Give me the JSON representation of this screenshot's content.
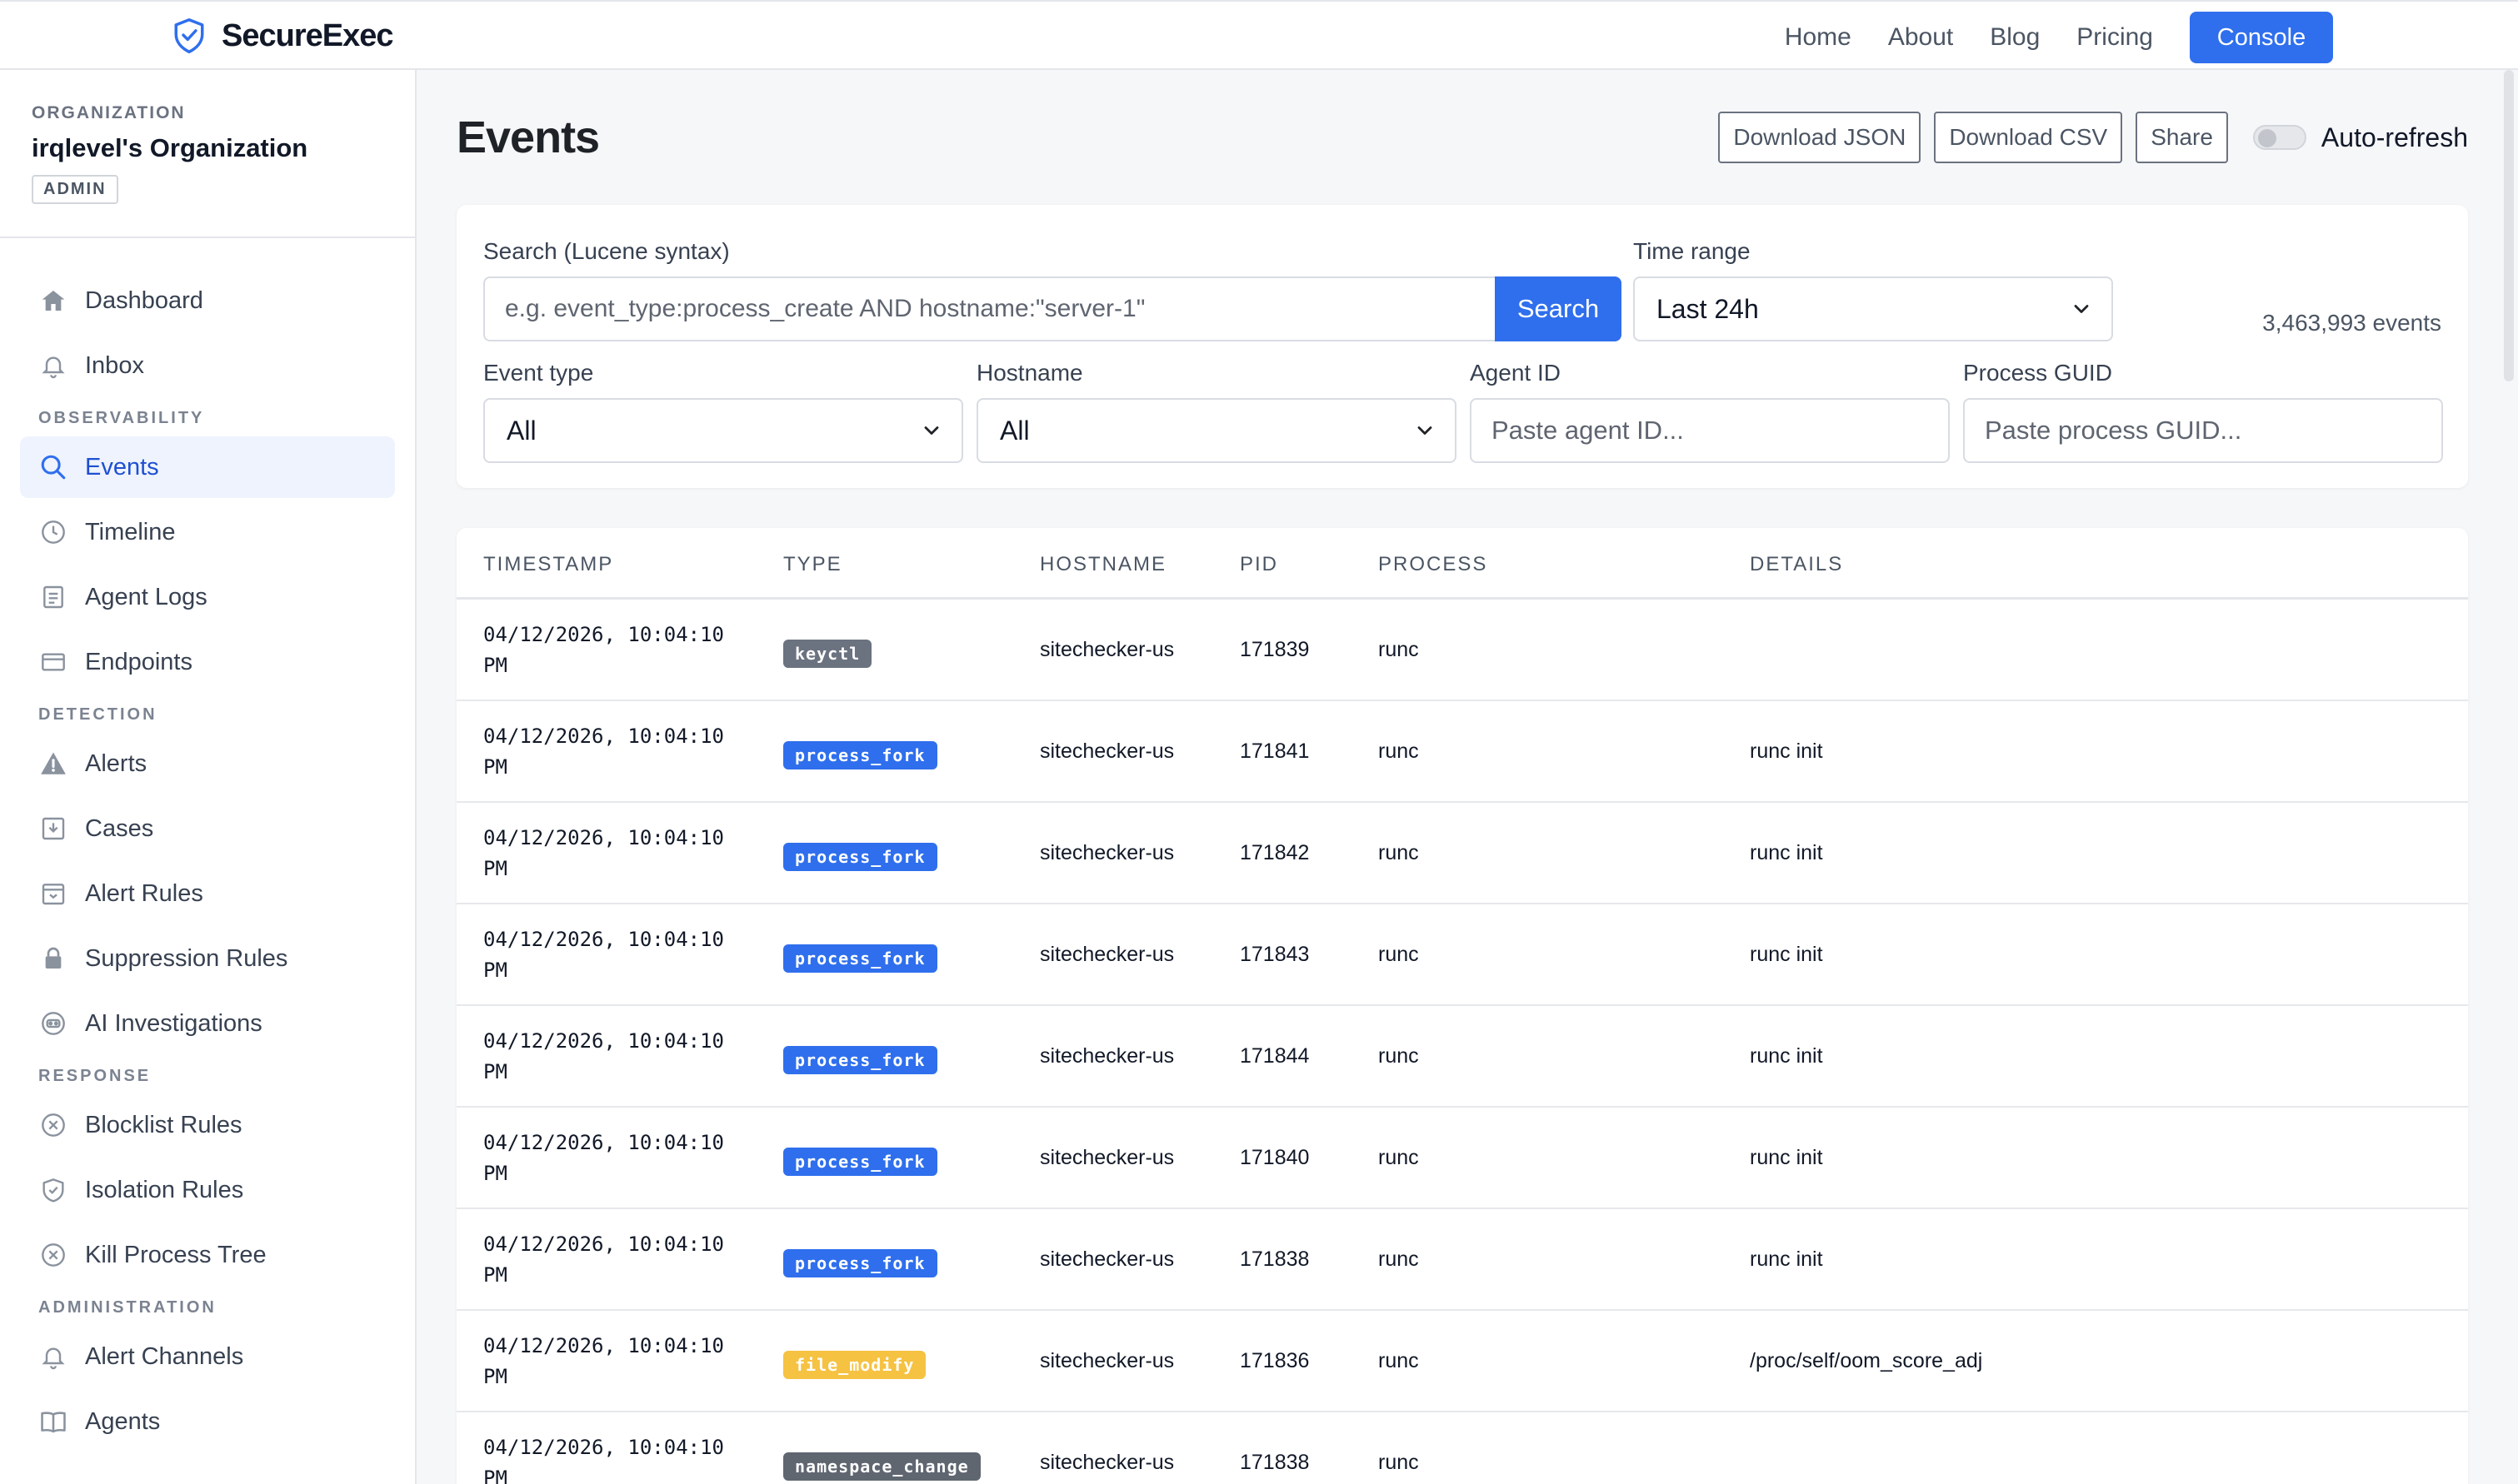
{
  "brand": {
    "name": "SecureExec"
  },
  "topnav": {
    "links": [
      "Home",
      "About",
      "Blog",
      "Pricing"
    ],
    "console_label": "Console"
  },
  "org": {
    "label": "ORGANIZATION",
    "name": "irqlevel's Organization",
    "role": "ADMIN"
  },
  "sidebar": {
    "top_items": [
      {
        "label": "Dashboard",
        "icon": "home-icon"
      },
      {
        "label": "Inbox",
        "icon": "bell-icon"
      }
    ],
    "sections": [
      {
        "label": "OBSERVABILITY",
        "items": [
          {
            "label": "Events",
            "icon": "search-icon",
            "active": true
          },
          {
            "label": "Timeline",
            "icon": "clock-icon"
          },
          {
            "label": "Agent Logs",
            "icon": "document-icon"
          },
          {
            "label": "Endpoints",
            "icon": "card-icon"
          }
        ]
      },
      {
        "label": "DETECTION",
        "items": [
          {
            "label": "Alerts",
            "icon": "warning-icon"
          },
          {
            "label": "Cases",
            "icon": "inbox-download-icon"
          },
          {
            "label": "Alert Rules",
            "icon": "calendar-icon"
          },
          {
            "label": "Suppression Rules",
            "icon": "lock-icon"
          },
          {
            "label": "AI Investigations",
            "icon": "robot-icon"
          }
        ]
      },
      {
        "label": "RESPONSE",
        "items": [
          {
            "label": "Blocklist Rules",
            "icon": "x-circle-icon"
          },
          {
            "label": "Isolation Rules",
            "icon": "shield-icon"
          },
          {
            "label": "Kill Process Tree",
            "icon": "x-circle-icon"
          }
        ]
      },
      {
        "label": "ADMINISTRATION",
        "items": [
          {
            "label": "Alert Channels",
            "icon": "bell-icon"
          },
          {
            "label": "Agents",
            "icon": "book-icon"
          }
        ]
      }
    ]
  },
  "page": {
    "title": "Events",
    "download_json_label": "Download JSON",
    "download_csv_label": "Download CSV",
    "share_label": "Share",
    "auto_refresh_label": "Auto-refresh",
    "auto_refresh_on": false
  },
  "filters": {
    "search_label": "Search (Lucene syntax)",
    "search_placeholder": "e.g. event_type:process_create AND hostname:\"server-1\"",
    "search_button": "Search",
    "time_range_label": "Time range",
    "time_range_value": "Last 24h",
    "event_count": "3,463,993 events",
    "event_type_label": "Event type",
    "event_type_value": "All",
    "hostname_label": "Hostname",
    "hostname_value": "All",
    "agent_id_label": "Agent ID",
    "agent_id_placeholder": "Paste agent ID...",
    "process_guid_label": "Process GUID",
    "process_guid_placeholder": "Paste process GUID..."
  },
  "table": {
    "columns": [
      "TIMESTAMP",
      "TYPE",
      "HOSTNAME",
      "PID",
      "PROCESS",
      "DETAILS"
    ],
    "type_colors": {
      "keyctl": "#6b7280",
      "process_fork": "#2f6fed",
      "file_modify": "#f5c242",
      "namespace_change": "#5f6670"
    },
    "rows": [
      {
        "ts_date": "04/12/2026, 10:04:10",
        "ts_ampm": "PM",
        "type": "keyctl",
        "hostname": "sitechecker-us",
        "pid": "171839",
        "process": "runc",
        "details": ""
      },
      {
        "ts_date": "04/12/2026, 10:04:10",
        "ts_ampm": "PM",
        "type": "process_fork",
        "hostname": "sitechecker-us",
        "pid": "171841",
        "process": "runc",
        "details": "runc init"
      },
      {
        "ts_date": "04/12/2026, 10:04:10",
        "ts_ampm": "PM",
        "type": "process_fork",
        "hostname": "sitechecker-us",
        "pid": "171842",
        "process": "runc",
        "details": "runc init"
      },
      {
        "ts_date": "04/12/2026, 10:04:10",
        "ts_ampm": "PM",
        "type": "process_fork",
        "hostname": "sitechecker-us",
        "pid": "171843",
        "process": "runc",
        "details": "runc init"
      },
      {
        "ts_date": "04/12/2026, 10:04:10",
        "ts_ampm": "PM",
        "type": "process_fork",
        "hostname": "sitechecker-us",
        "pid": "171844",
        "process": "runc",
        "details": "runc init"
      },
      {
        "ts_date": "04/12/2026, 10:04:10",
        "ts_ampm": "PM",
        "type": "process_fork",
        "hostname": "sitechecker-us",
        "pid": "171840",
        "process": "runc",
        "details": "runc init"
      },
      {
        "ts_date": "04/12/2026, 10:04:10",
        "ts_ampm": "PM",
        "type": "process_fork",
        "hostname": "sitechecker-us",
        "pid": "171838",
        "process": "runc",
        "details": "runc init"
      },
      {
        "ts_date": "04/12/2026, 10:04:10",
        "ts_ampm": "PM",
        "type": "file_modify",
        "hostname": "sitechecker-us",
        "pid": "171836",
        "process": "runc",
        "details": "/proc/self/oom_score_adj"
      },
      {
        "ts_date": "04/12/2026, 10:04:10",
        "ts_ampm": "PM",
        "type": "namespace_change",
        "hostname": "sitechecker-us",
        "pid": "171838",
        "process": "runc",
        "details": ""
      }
    ]
  }
}
